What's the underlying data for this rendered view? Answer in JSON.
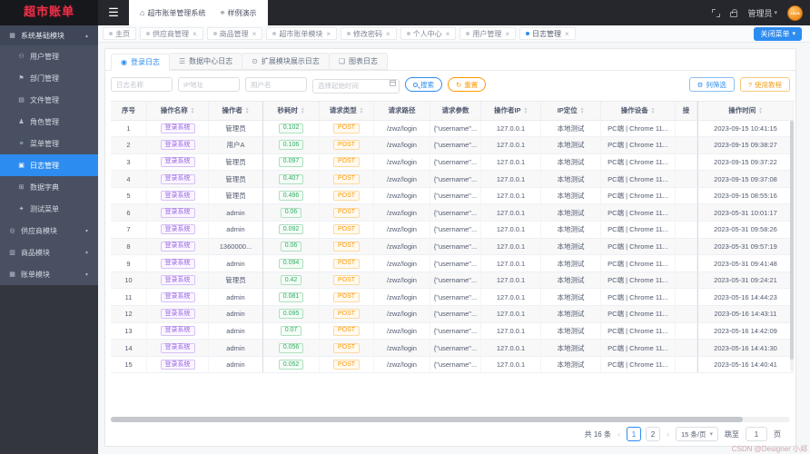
{
  "colors": {
    "accent": "#2d8cf0",
    "orange": "#ff9900",
    "green": "#19be6b",
    "purple": "#9a66e4",
    "sidebar_active": "#2d8cf0"
  },
  "topbar": {
    "logo": "超市账单",
    "app_title": "超市账单管理系统",
    "demo": "样例演示",
    "user": "管理员",
    "avatar": "JAVA"
  },
  "tabbar": {
    "close_menu": "关闭菜单",
    "tabs": [
      {
        "label": "主页",
        "active": false,
        "closable": false
      },
      {
        "label": "供应商管理",
        "active": false,
        "closable": true
      },
      {
        "label": "商品管理",
        "active": false,
        "closable": true
      },
      {
        "label": "超市账单模块",
        "active": false,
        "closable": true
      },
      {
        "label": "修改密码",
        "active": false,
        "closable": true
      },
      {
        "label": "个人中心",
        "active": false,
        "closable": true
      },
      {
        "label": "用户管理",
        "active": false,
        "closable": true
      },
      {
        "label": "日志管理",
        "active": true,
        "closable": true
      }
    ]
  },
  "sidebar": {
    "group": {
      "label": "系统基础模块",
      "icon": "grid-icon",
      "expanded": true
    },
    "items": [
      {
        "label": "用户管理",
        "icon": "user-icon",
        "active": false
      },
      {
        "label": "部门管理",
        "icon": "department-icon",
        "active": false
      },
      {
        "label": "文件管理",
        "icon": "file-icon",
        "active": false
      },
      {
        "label": "角色管理",
        "icon": "role-icon",
        "active": false
      },
      {
        "label": "菜单管理",
        "icon": "menu-icon",
        "active": false
      },
      {
        "label": "日志管理",
        "icon": "log-icon",
        "active": true
      },
      {
        "label": "数据字典",
        "icon": "dictionary-icon",
        "active": false
      },
      {
        "label": "测试菜单",
        "icon": "test-icon",
        "active": false
      }
    ],
    "collapsed_groups": [
      {
        "label": "供应商模块",
        "icon": "supplier-icon"
      },
      {
        "label": "商品模块",
        "icon": "goods-icon"
      },
      {
        "label": "账单模块",
        "icon": "bill-icon"
      }
    ]
  },
  "log_tabs": [
    {
      "label": "登录日志",
      "icon": "login-log-icon",
      "active": true
    },
    {
      "label": "数据中心日志",
      "icon": "data-log-icon",
      "active": false
    },
    {
      "label": "扩展模块展示日志",
      "icon": "extend-log-icon",
      "active": false
    },
    {
      "label": "图表日志",
      "icon": "chart-log-icon",
      "active": false
    }
  ],
  "filters": {
    "log_name_placeholder": "日志名称",
    "ip_placeholder": "IP地址",
    "username_placeholder": "用户名",
    "time_placeholder": "选择起始时间",
    "search": "搜索",
    "reset": "重置",
    "column_filter": "列筛选",
    "tutorial": "使用教程"
  },
  "table": {
    "columns": [
      {
        "label": "序号",
        "sortable": false
      },
      {
        "label": "操作名称",
        "sortable": true
      },
      {
        "label": "操作者",
        "sortable": true
      },
      {
        "label": "秒耗时",
        "sortable": true
      },
      {
        "label": "请求类型",
        "sortable": true
      },
      {
        "label": "请求路径",
        "sortable": false
      },
      {
        "label": "请求参数",
        "sortable": false
      },
      {
        "label": "操作者IP",
        "sortable": true
      },
      {
        "label": "IP定位",
        "sortable": true
      },
      {
        "label": "操作设备",
        "sortable": true
      },
      {
        "label": "接",
        "sortable": false
      },
      {
        "label": "操作时间",
        "sortable": true
      }
    ],
    "rows": [
      {
        "no": "1",
        "name": "登录系统",
        "operator": "管理员",
        "seconds": "0.102",
        "type": "POST",
        "path": "/zwz/login",
        "params": "{\"username\"...",
        "ip": "127.0.0.1",
        "location": "本地测试",
        "device": "PC端 | Chrome 11...",
        "extra": "",
        "time": "2023-09-15 10:41:15"
      },
      {
        "no": "2",
        "name": "登录系统",
        "operator": "用户A",
        "seconds": "0.106",
        "type": "POST",
        "path": "/zwz/login",
        "params": "{\"username\"...",
        "ip": "127.0.0.1",
        "location": "本地测试",
        "device": "PC端 | Chrome 11...",
        "extra": "",
        "time": "2023-09-15 09:38:27"
      },
      {
        "no": "3",
        "name": "登录系统",
        "operator": "管理员",
        "seconds": "0.097",
        "type": "POST",
        "path": "/zwz/login",
        "params": "{\"username\"...",
        "ip": "127.0.0.1",
        "location": "本地测试",
        "device": "PC端 | Chrome 11...",
        "extra": "",
        "time": "2023-09-15 09:37:22"
      },
      {
        "no": "4",
        "name": "登录系统",
        "operator": "管理员",
        "seconds": "0.407",
        "type": "POST",
        "path": "/zwz/login",
        "params": "{\"username\"...",
        "ip": "127.0.0.1",
        "location": "本地测试",
        "device": "PC端 | Chrome 11...",
        "extra": "",
        "time": "2023-09-15 09:37:08"
      },
      {
        "no": "5",
        "name": "登录系统",
        "operator": "管理员",
        "seconds": "0.496",
        "type": "POST",
        "path": "/zwz/login",
        "params": "{\"username\"...",
        "ip": "127.0.0.1",
        "location": "本地测试",
        "device": "PC端 | Chrome 11...",
        "extra": "",
        "time": "2023-09-15 08:55:16"
      },
      {
        "no": "6",
        "name": "登录系统",
        "operator": "admin",
        "seconds": "0.06",
        "type": "POST",
        "path": "/zwz/login",
        "params": "{\"username\"...",
        "ip": "127.0.0.1",
        "location": "本地测试",
        "device": "PC端 | Chrome 11...",
        "extra": "",
        "time": "2023-05-31 10:01:17"
      },
      {
        "no": "7",
        "name": "登录系统",
        "operator": "admin",
        "seconds": "0.092",
        "type": "POST",
        "path": "/zwz/login",
        "params": "{\"username\"...",
        "ip": "127.0.0.1",
        "location": "本地测试",
        "device": "PC端 | Chrome 11...",
        "extra": "",
        "time": "2023-05-31 09:58:26"
      },
      {
        "no": "8",
        "name": "登录系统",
        "operator": "1360000...",
        "seconds": "0.06",
        "type": "POST",
        "path": "/zwz/login",
        "params": "{\"username\"...",
        "ip": "127.0.0.1",
        "location": "本地测试",
        "device": "PC端 | Chrome 11...",
        "extra": "",
        "time": "2023-05-31 09:57:19"
      },
      {
        "no": "9",
        "name": "登录系统",
        "operator": "admin",
        "seconds": "0.094",
        "type": "POST",
        "path": "/zwz/login",
        "params": "{\"username\"...",
        "ip": "127.0.0.1",
        "location": "本地测试",
        "device": "PC端 | Chrome 11...",
        "extra": "",
        "time": "2023-05-31 09:41:48"
      },
      {
        "no": "10",
        "name": "登录系统",
        "operator": "管理员",
        "seconds": "0.42",
        "type": "POST",
        "path": "/zwz/login",
        "params": "{\"username\"...",
        "ip": "127.0.0.1",
        "location": "本地测试",
        "device": "PC端 | Chrome 11...",
        "extra": "",
        "time": "2023-05-31 09:24:21"
      },
      {
        "no": "11",
        "name": "登录系统",
        "operator": "admin",
        "seconds": "0.081",
        "type": "POST",
        "path": "/zwz/login",
        "params": "{\"username\"...",
        "ip": "127.0.0.1",
        "location": "本地测试",
        "device": "PC端 | Chrome 11...",
        "extra": "",
        "time": "2023-05-16 14:44:23"
      },
      {
        "no": "12",
        "name": "登录系统",
        "operator": "admin",
        "seconds": "0.095",
        "type": "POST",
        "path": "/zwz/login",
        "params": "{\"username\"...",
        "ip": "127.0.0.1",
        "location": "本地测试",
        "device": "PC端 | Chrome 11...",
        "extra": "",
        "time": "2023-05-16 14:43:11"
      },
      {
        "no": "13",
        "name": "登录系统",
        "operator": "admin",
        "seconds": "0.07",
        "type": "POST",
        "path": "/zwz/login",
        "params": "{\"username\"...",
        "ip": "127.0.0.1",
        "location": "本地测试",
        "device": "PC端 | Chrome 11...",
        "extra": "",
        "time": "2023-05-16 14:42:09"
      },
      {
        "no": "14",
        "name": "登录系统",
        "operator": "admin",
        "seconds": "0.056",
        "type": "POST",
        "path": "/zwz/login",
        "params": "{\"username\"...",
        "ip": "127.0.0.1",
        "location": "本地测试",
        "device": "PC端 | Chrome 11...",
        "extra": "",
        "time": "2023-05-16 14:41:30"
      },
      {
        "no": "15",
        "name": "登录系统",
        "operator": "admin",
        "seconds": "0.052",
        "type": "POST",
        "path": "/zwz/login",
        "params": "{\"username\"...",
        "ip": "127.0.0.1",
        "location": "本地测试",
        "device": "PC端 | Chrome 11...",
        "extra": "",
        "time": "2023-05-16 14:40:41"
      }
    ]
  },
  "pagination": {
    "total": "共 16 条",
    "pages": [
      "1",
      "2"
    ],
    "current": "1",
    "page_size": "15 条/页",
    "jump_label": "跳至",
    "jump_value": "1",
    "jump_suffix": "页"
  },
  "watermark": "CSDN @Designer 小郑"
}
